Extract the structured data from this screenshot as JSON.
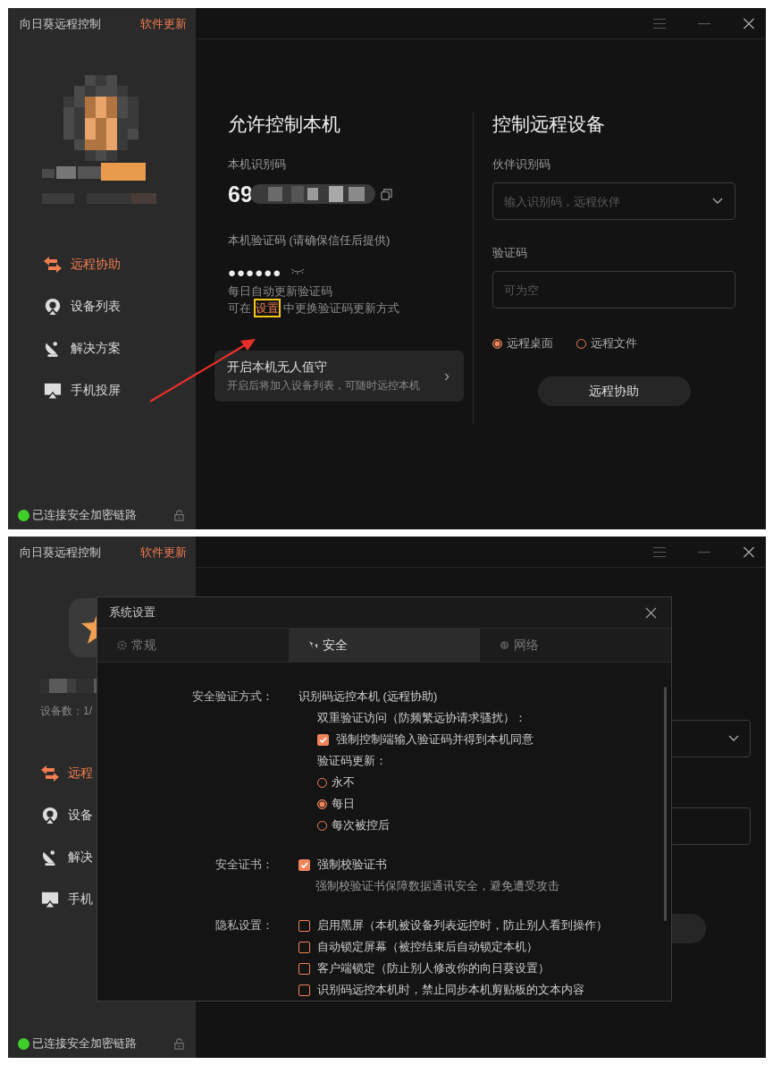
{
  "top_screen": {
    "title": "向日葵远程控制",
    "update_link": "软件更新",
    "nav": [
      {
        "label": "远程协助",
        "selected": true
      },
      {
        "label": "设备列表",
        "selected": false
      },
      {
        "label": "解决方案",
        "selected": false
      },
      {
        "label": "手机投屏",
        "selected": false
      }
    ],
    "status": "已连接安全加密链路",
    "allow": {
      "heading": "允许控制本机",
      "id_label": "本机识别码",
      "id_value": "69",
      "code_label": "本机验证码 (请确保信任后提供)",
      "code_value": "●●●●●●",
      "note": "每日自动更新验证码",
      "hint_before": "可在",
      "hint_link": "设置",
      "hint_after": "中更换验证码更新方式"
    },
    "unattended": {
      "title": "开启本机无人值守",
      "subtitle": "开启后将加入设备列表，可随时远控本机",
      "chevron": "›"
    },
    "remote": {
      "heading": "控制远程设备",
      "partner_label": "伙伴识别码",
      "partner_placeholder": "输入识别码，远程伙伴",
      "code_label": "验证码",
      "code_placeholder": "可为空",
      "modes": [
        {
          "label": "远程桌面",
          "selected": true
        },
        {
          "label": "远程文件",
          "selected": false
        }
      ],
      "button": "远程协助"
    }
  },
  "bottom_screen": {
    "title": "向日葵远程控制",
    "update_link": "软件更新",
    "device_count": "设备数：1/",
    "nav": [
      {
        "label": "远程",
        "selected": true
      },
      {
        "label": "设备",
        "selected": false
      },
      {
        "label": "解决",
        "selected": false
      },
      {
        "label": "手机",
        "selected": false
      }
    ],
    "status": "已连接安全加密链路",
    "dialog": {
      "title": "系统设置",
      "tabs": [
        {
          "label": "常规",
          "selected": false
        },
        {
          "label": "安全",
          "selected": true
        },
        {
          "label": "网络",
          "selected": false
        }
      ],
      "sections": [
        {
          "label": "安全验证方式：",
          "items": [
            {
              "kind": "text",
              "text": "识别码远控本机 (远程协助)",
              "children": [
                {
                  "kind": "text",
                  "text": "双重验证访问（防频繁远协请求骚扰）："
                },
                {
                  "kind": "checkbox",
                  "text": "强制控制端输入验证码并得到本机同意",
                  "checked": true
                },
                {
                  "kind": "text",
                  "text": "验证码更新："
                },
                {
                  "kind": "radio",
                  "text": "永不",
                  "selected": false
                },
                {
                  "kind": "radio",
                  "text": "每日",
                  "selected": true
                },
                {
                  "kind": "radio",
                  "text": "每次被控后",
                  "selected": false
                }
              ]
            }
          ]
        },
        {
          "label": "安全证书：",
          "items": [
            {
              "kind": "checkbox",
              "text": "强制校验证书",
              "checked": true,
              "hint": "强制校验证书保障数据通讯安全，避免遭受攻击"
            }
          ]
        },
        {
          "label": "隐私设置：",
          "items": [
            {
              "kind": "checkbox",
              "text": "启用黑屏（本机被设备列表远控时，防止别人看到操作）",
              "checked": false
            },
            {
              "kind": "checkbox",
              "text": "自动锁定屏幕（被控结束后自动锁定本机）",
              "checked": false
            },
            {
              "kind": "checkbox",
              "text": "客户端锁定（防止别人修改你的向日葵设置）",
              "checked": false
            },
            {
              "kind": "checkbox",
              "text": "识别码远控本机时，禁止同步本机剪贴板的文本内容",
              "checked": false
            }
          ]
        }
      ]
    }
  }
}
